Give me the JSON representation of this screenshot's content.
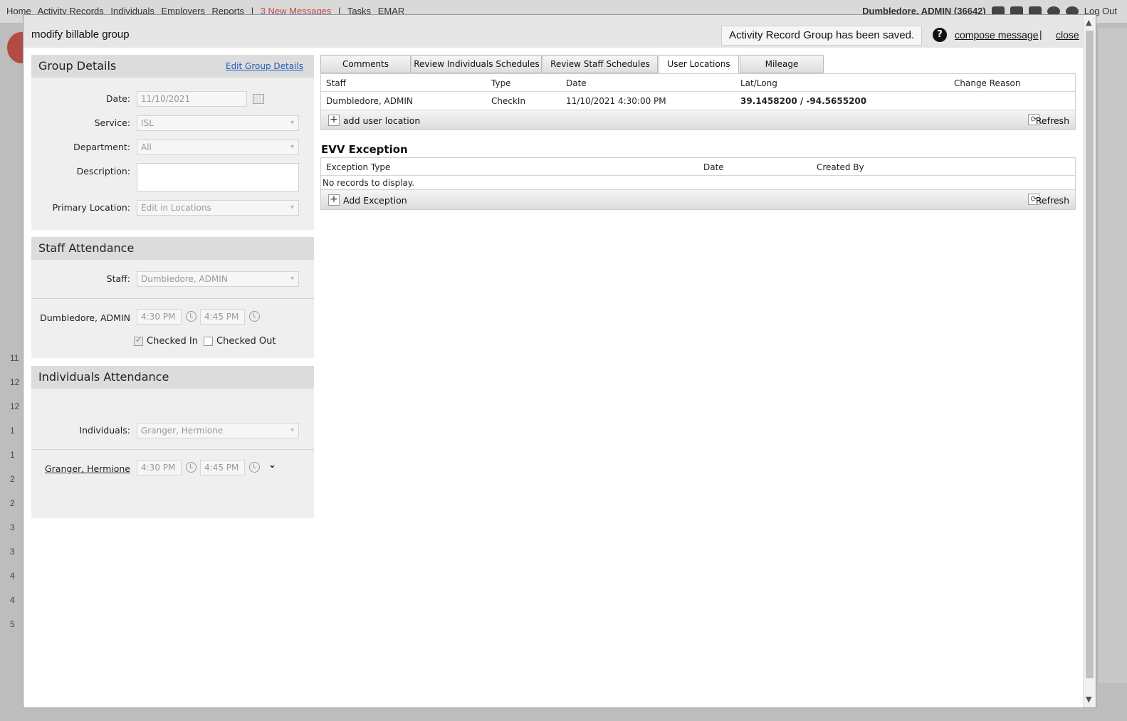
{
  "background": {
    "nav_items": [
      "Home",
      "Activity Records",
      "Individuals",
      "Employers",
      "Reports",
      "|",
      "3 New Messages",
      "|",
      "Tasks",
      "EMAR"
    ],
    "user": "Dumbledore, ADMIN (36642)",
    "logout": "Log Out",
    "row_numbers": [
      "11",
      "12",
      "12",
      "1",
      "1",
      "2",
      "2",
      "3",
      "3",
      "4",
      "4",
      "5"
    ]
  },
  "modal": {
    "title": "modify billable group",
    "saved_notice": "Activity Record Group has been saved.",
    "help": "?",
    "compose": "compose message",
    "pipe": "|",
    "close": "close"
  },
  "group_details": {
    "heading": "Group Details",
    "edit_link": "Edit Group Details",
    "date_label": "Date:",
    "date_value": "11/10/2021",
    "service_label": "Service:",
    "service_value": "ISL",
    "department_label": "Department:",
    "department_value": "All",
    "description_label": "Description:",
    "primary_location_label": "Primary Location:",
    "primary_location_value": "Edit in Locations"
  },
  "staff_attendance": {
    "heading": "Staff Attendance",
    "staff_label": "Staff:",
    "staff_value": "Dumbledore, ADMIN",
    "person": "Dumbledore, ADMIN",
    "start_time": "4:30 PM",
    "end_time": "4:45 PM",
    "checked_in_label": "Checked In",
    "checked_out_label": "Checked Out"
  },
  "individuals_attendance": {
    "heading": "Individuals Attendance",
    "individuals_label": "Individuals:",
    "individuals_value": "Granger, Hermione",
    "person": "Granger, Hermione",
    "start_time": "4:30 PM",
    "end_time": "4:45 PM"
  },
  "tabs": [
    "Comments",
    "Review Individuals Schedules",
    "Review Staff Schedules",
    "User Locations",
    "Mileage"
  ],
  "user_locations": {
    "columns": [
      "Staff",
      "Type",
      "Date",
      "Lat/Long",
      "Change Reason"
    ],
    "rows": [
      {
        "staff": "Dumbledore, ADMIN",
        "type": "CheckIn",
        "date": "11/10/2021 4:30:00 PM",
        "latlong": "39.1458200 / -94.5655200",
        "reason": ""
      }
    ],
    "add_label": "add user location",
    "refresh_label": "Refresh"
  },
  "evv_exception": {
    "title": "EVV Exception",
    "columns": [
      "Exception Type",
      "Date",
      "Created By"
    ],
    "empty": "No records to display.",
    "add_label": "Add Exception",
    "refresh_label": "Refresh"
  }
}
